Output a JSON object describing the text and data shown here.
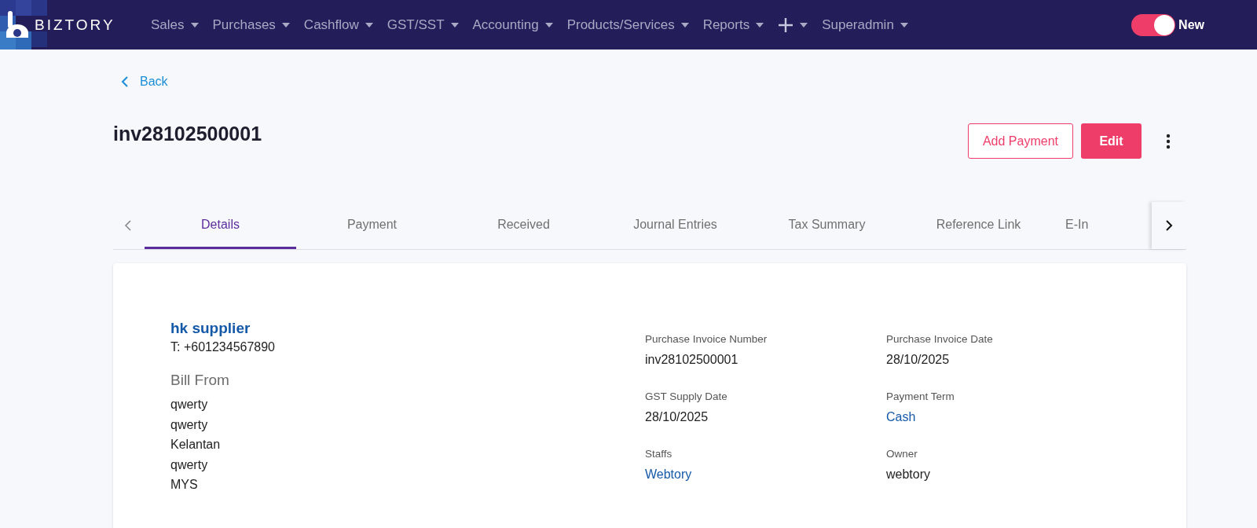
{
  "brand": "BIZTORY",
  "nav": [
    {
      "kind": "text",
      "label": "Sales"
    },
    {
      "kind": "text",
      "label": "Purchases"
    },
    {
      "kind": "text",
      "label": "Cashflow"
    },
    {
      "kind": "text",
      "label": "GST/SST"
    },
    {
      "kind": "text",
      "label": "Accounting"
    },
    {
      "kind": "text",
      "label": "Products/Services"
    },
    {
      "kind": "text",
      "label": "Reports"
    },
    {
      "kind": "plus"
    },
    {
      "kind": "text",
      "label": "Superadmin"
    }
  ],
  "new_toggle": {
    "label": "New",
    "on": true
  },
  "back": "Back",
  "title": "inv28102500001",
  "actions": {
    "add_payment": "Add Payment",
    "edit": "Edit"
  },
  "tabs": [
    {
      "label": "Details",
      "selected": true
    },
    {
      "label": "Payment",
      "selected": false
    },
    {
      "label": "Received",
      "selected": false
    },
    {
      "label": "Journal Entries",
      "selected": false
    },
    {
      "label": "Tax Summary",
      "selected": false
    },
    {
      "label": "Reference Link",
      "selected": false
    },
    {
      "label": "E-In",
      "selected": false
    }
  ],
  "supplier": {
    "name": "hk supplier",
    "phone": "T: +601234567890",
    "bill_from_heading": "Bill From",
    "address": [
      "qwerty",
      "qwerty",
      "Kelantan",
      "qwerty",
      "MYS"
    ]
  },
  "fields": [
    {
      "label": "Purchase Invoice Number",
      "value": "inv28102500001",
      "kind": "text"
    },
    {
      "label": "Purchase Invoice Date",
      "value": "28/10/2025",
      "kind": "text"
    },
    {
      "label": "GST Supply Date",
      "value": "28/10/2025",
      "kind": "text"
    },
    {
      "label": "Payment Term",
      "value": "Cash",
      "kind": "link"
    },
    {
      "label": "Staffs",
      "value": "Webtory",
      "kind": "link"
    },
    {
      "label": "Owner",
      "value": "webtory",
      "kind": "text"
    }
  ]
}
